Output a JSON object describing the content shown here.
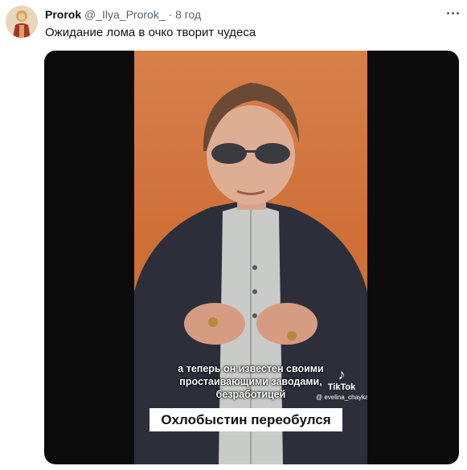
{
  "tweet": {
    "author_name": "Prorok",
    "handle": "@_Ilya_Prorok_",
    "separator": "·",
    "time": "8 год",
    "text": "Ожидание лома в очко творит чудеса",
    "more_icon": "more-horizontal-icon"
  },
  "media": {
    "subtitle_lines": [
      "а теперь он известен своими",
      "простаивающими заводами,",
      "безработицей"
    ],
    "tiktok_label": "TikTok",
    "tiktok_user": "@ evelina_chayka",
    "caption": "Охлобыстин переобулся"
  },
  "colors": {
    "text": "#0f1419",
    "muted": "#536471",
    "video_bg": "#cf6f38",
    "letterbox": "#0b0b0b"
  }
}
